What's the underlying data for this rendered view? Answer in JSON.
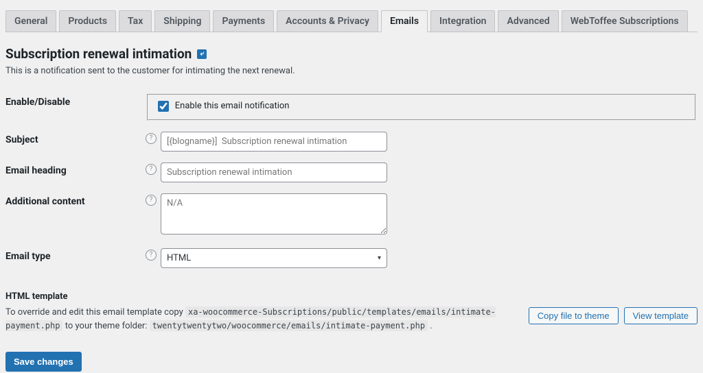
{
  "tabs": {
    "general": "General",
    "products": "Products",
    "tax": "Tax",
    "shipping": "Shipping",
    "payments": "Payments",
    "accounts": "Accounts & Privacy",
    "emails": "Emails",
    "integration": "Integration",
    "advanced": "Advanced",
    "webtoffee": "WebToffee Subscriptions",
    "active": "emails"
  },
  "page": {
    "title": "Subscription renewal intimation",
    "description": "This is a notification sent to the customer for intimating the next renewal."
  },
  "fields": {
    "enable": {
      "label": "Enable/Disable",
      "checkbox_label": "Enable this email notification",
      "checked": true
    },
    "subject": {
      "label": "Subject",
      "placeholder": "[{blogname}]  Subscription renewal intimation",
      "value": ""
    },
    "heading": {
      "label": "Email heading",
      "placeholder": "Subscription renewal intimation",
      "value": ""
    },
    "additional": {
      "label": "Additional content",
      "placeholder": "N/A",
      "value": ""
    },
    "email_type": {
      "label": "Email type",
      "selected": "HTML"
    }
  },
  "template": {
    "section_label": "HTML template",
    "override_prefix": "To override and edit this email template copy ",
    "code1": "xa-woocommerce-Subscriptions/public/templates/emails/intimate-payment.php",
    "middle": " to your theme folder: ",
    "code2": "twentytwentytwo/woocommerce/emails/intimate-payment.php",
    "ending": " .",
    "copy_button": "Copy file to theme",
    "view_button": "View template"
  },
  "actions": {
    "save": "Save changes"
  }
}
